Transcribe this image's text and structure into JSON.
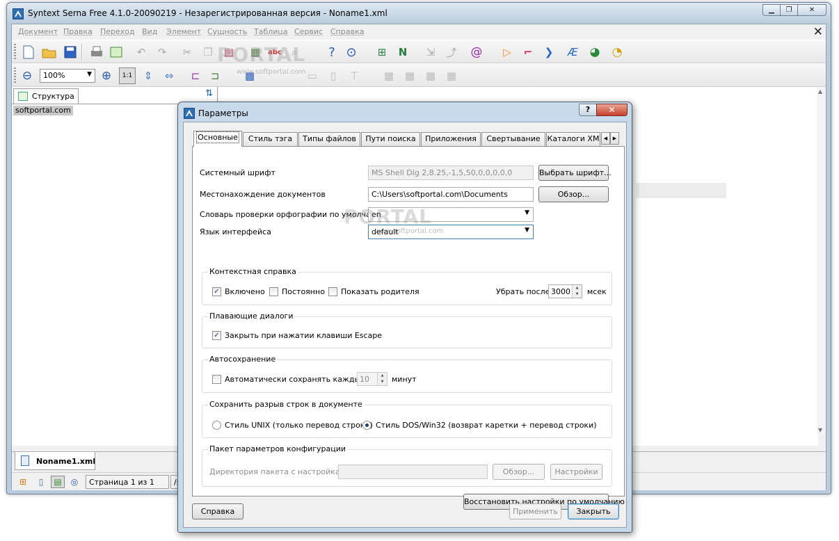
{
  "main_window": {
    "title": "Syntext Serna Free 4.1.0-20090219 - Незарегистрированная версия - Noname1.xml",
    "menu": [
      "Документ",
      "Правка",
      "Переход",
      "Вид",
      "Элемент",
      "Сущность",
      "Таблица",
      "Сервис",
      "Справка"
    ],
    "zoom": "100%",
    "structure_tab": "Структура",
    "tree_item": "softportal.com",
    "doc_tab": "Noname1.xml",
    "status_page": "Страница 1 из 1",
    "status_path": "/s"
  },
  "watermark": {
    "text": "PORTAL",
    "url": "www.softportal.com"
  },
  "dialog": {
    "title": "Параметры",
    "help_btn": "?",
    "tabs": [
      "Основные",
      "Стиль тэга",
      "Типы файлов",
      "Пути поиска",
      "Приложения",
      "Свертывание",
      "Каталоги XM"
    ],
    "system_font_label": "Системный шрифт",
    "system_font_value": "MS Shell Dlg 2,8.25,-1,5,50,0,0,0,0,0",
    "choose_font_btn": "Выбрать шрифт...",
    "docs_location_label": "Местонахождение документов",
    "docs_location_value": "C:\\Users\\softportal.com\\Documents",
    "browse_btn": "Обзор...",
    "spell_dict_label": "Словарь проверки орфографии по умолчанию",
    "spell_dict_value": "en",
    "ui_lang_label": "Язык интерфейса",
    "ui_lang_value": "default",
    "context_help": {
      "title": "Контекстная справка",
      "enabled": "Включено",
      "permanent": "Постоянно",
      "show_parent": "Показать родителя",
      "remove_after": "Убрать после",
      "remove_value": "3000",
      "unit": "мсек"
    },
    "floating": {
      "title": "Плавающие диалоги",
      "close_escape": "Закрыть при нажатии клавиши Escape"
    },
    "autosave": {
      "title": "Автосохранение",
      "label": "Автоматически сохранять каждые",
      "value": "10",
      "unit": "минут"
    },
    "linebreak": {
      "title": "Сохранить разрыв строк в документе",
      "unix": "Стиль UNIX (только перевод строки)",
      "dos": "Стиль DOS/Win32 (возврат каретки + перевод строки)"
    },
    "config_pkg": {
      "title": "Пакет параметров конфигурации",
      "dir_label": "Директория пакета с настройками",
      "browse": "Обзор...",
      "settings": "Настройки"
    },
    "restore_defaults": "Восстановить настройки по умолчанию",
    "help": "Справка",
    "apply": "Применить",
    "close": "Закрыть"
  }
}
